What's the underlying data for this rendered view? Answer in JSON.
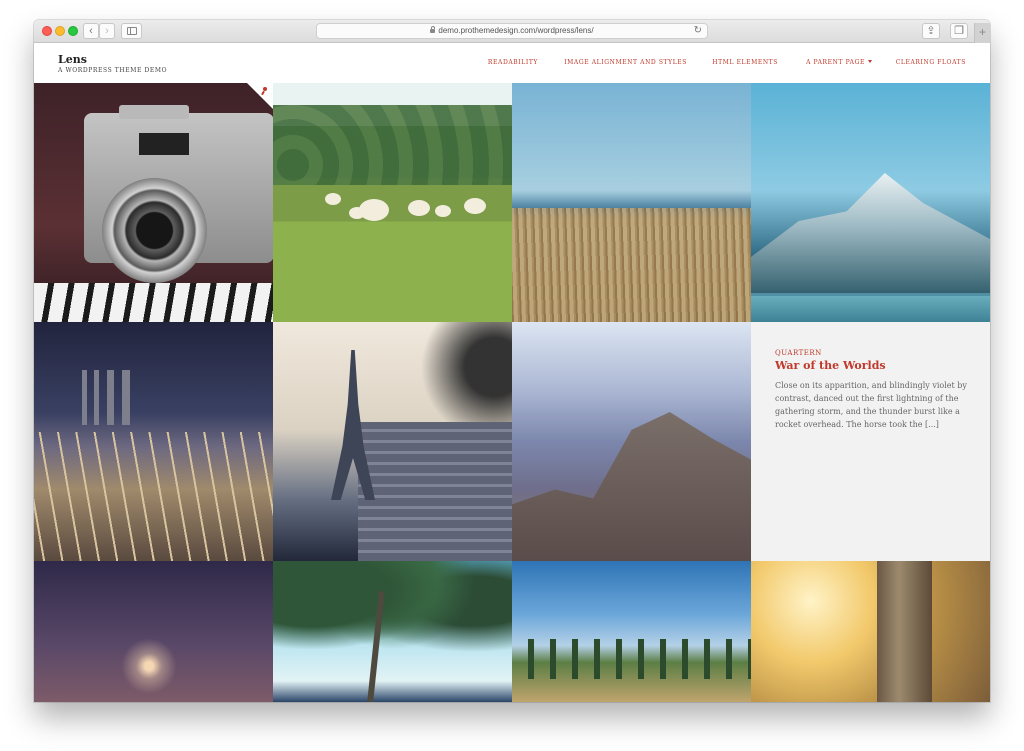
{
  "browser": {
    "url": "demo.prothemedesign.com/wordpress/lens/",
    "back_icon": "‹",
    "forward_icon": "›",
    "reload_icon": "↻",
    "share_icon": "⇪",
    "tabs_icon": "❐",
    "new_tab_icon": "+"
  },
  "site": {
    "title": "Lens",
    "description": "A WORDPRESS THEME DEMO"
  },
  "nav": {
    "items": [
      {
        "label": "READABILITY"
      },
      {
        "label": "IMAGE ALIGNMENT AND STYLES"
      },
      {
        "label": "HTML ELEMENTS"
      },
      {
        "label": "A PARENT PAGE"
      },
      {
        "label": "CLEARING FLOATS"
      }
    ]
  },
  "post": {
    "category": "QUARTERN",
    "title": "War of the Worlds",
    "excerpt": "Close on its apparition, and blindingly violet by contrast, danced out the first lightning of the gathering storm, and the thunder burst like a rocket overhead. The horse took the [...]"
  },
  "colors": {
    "accent": "#c0392b",
    "excerpt_bg": "#f2f2f2",
    "text": "#666666"
  }
}
